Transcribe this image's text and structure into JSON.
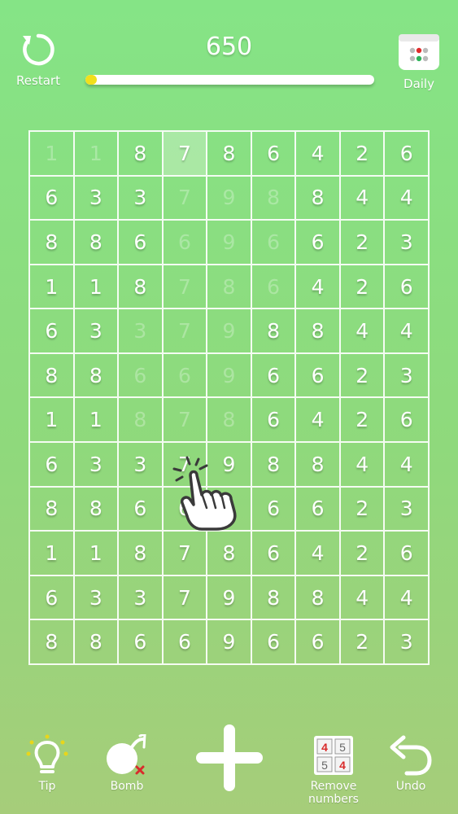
{
  "header": {
    "restart_label": "Restart",
    "daily_label": "Daily",
    "score": "650",
    "progress": 0.04
  },
  "board": {
    "rows": [
      [
        "1",
        "1",
        "8",
        "7",
        "8",
        "6",
        "4",
        "2",
        "6"
      ],
      [
        "6",
        "3",
        "3",
        "7",
        "9",
        "8",
        "8",
        "4",
        "4"
      ],
      [
        "8",
        "8",
        "6",
        "6",
        "9",
        "6",
        "6",
        "2",
        "3"
      ],
      [
        "1",
        "1",
        "8",
        "7",
        "8",
        "6",
        "4",
        "2",
        "6"
      ],
      [
        "6",
        "3",
        "3",
        "7",
        "9",
        "8",
        "8",
        "4",
        "4"
      ],
      [
        "8",
        "8",
        "6",
        "6",
        "9",
        "6",
        "6",
        "2",
        "3"
      ],
      [
        "1",
        "1",
        "8",
        "7",
        "8",
        "6",
        "4",
        "2",
        "6"
      ],
      [
        "6",
        "3",
        "3",
        "7",
        "9",
        "8",
        "8",
        "4",
        "4"
      ],
      [
        "8",
        "8",
        "6",
        "6",
        "9",
        "6",
        "6",
        "2",
        "3"
      ],
      [
        "1",
        "1",
        "8",
        "7",
        "8",
        "6",
        "4",
        "2",
        "6"
      ],
      [
        "6",
        "3",
        "3",
        "7",
        "9",
        "8",
        "8",
        "4",
        "4"
      ],
      [
        "8",
        "8",
        "6",
        "6",
        "9",
        "6",
        "6",
        "2",
        "3"
      ]
    ],
    "faded": [
      [
        0,
        0
      ],
      [
        0,
        1
      ],
      [
        1,
        3
      ],
      [
        1,
        4
      ],
      [
        1,
        5
      ],
      [
        2,
        3
      ],
      [
        2,
        4
      ],
      [
        2,
        5
      ],
      [
        3,
        3
      ],
      [
        3,
        4
      ],
      [
        3,
        5
      ],
      [
        4,
        2
      ],
      [
        4,
        3
      ],
      [
        4,
        4
      ],
      [
        5,
        2
      ],
      [
        5,
        3
      ],
      [
        5,
        4
      ],
      [
        6,
        2
      ],
      [
        6,
        3
      ],
      [
        6,
        4
      ]
    ],
    "selected": [
      0,
      3
    ]
  },
  "toolbar": {
    "tip_label": "Tip",
    "bomb_label": "Bomb",
    "remove_label_line1": "Remove",
    "remove_label_line2": "numbers",
    "undo_label": "Undo",
    "remove_icon_digits": [
      "4",
      "5",
      "5",
      "4"
    ]
  },
  "colors": {
    "progress_fill": "#f1df1b",
    "calendar_dots_red": "#e02b2b",
    "calendar_dots_green": "#2fb35a",
    "remove_icon_red": "#d92b2b",
    "bulb_dots": "#e8d61b"
  }
}
